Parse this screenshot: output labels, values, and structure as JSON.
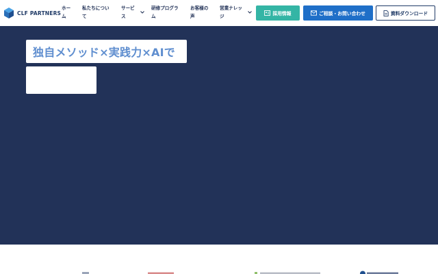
{
  "header": {
    "logo_text": "CLF PARTNERS",
    "nav": [
      {
        "line1": "ホー",
        "line2": "ム"
      },
      {
        "line1": "私たちについ",
        "line2": "て"
      },
      {
        "line1": "サービ",
        "line2": "ス"
      },
      {
        "line1": "研修プログラ",
        "line2": "ム"
      },
      {
        "line1": "お客様の",
        "line2": "声"
      },
      {
        "line1": "営業ナレッ",
        "line2": "ジ"
      }
    ],
    "buttons": {
      "recruit": "採用情報",
      "contact": "ご相談・お問い合わせ",
      "download": "資料ダウンロード"
    }
  },
  "hero": {
    "headline": "独自メソッド×実践力×AIで"
  },
  "colors": {
    "hero_bg": "#223258",
    "recruit_btn": "#34b5a5",
    "contact_btn": "#1f6fc8",
    "headline_text": "#5f8ecf"
  }
}
